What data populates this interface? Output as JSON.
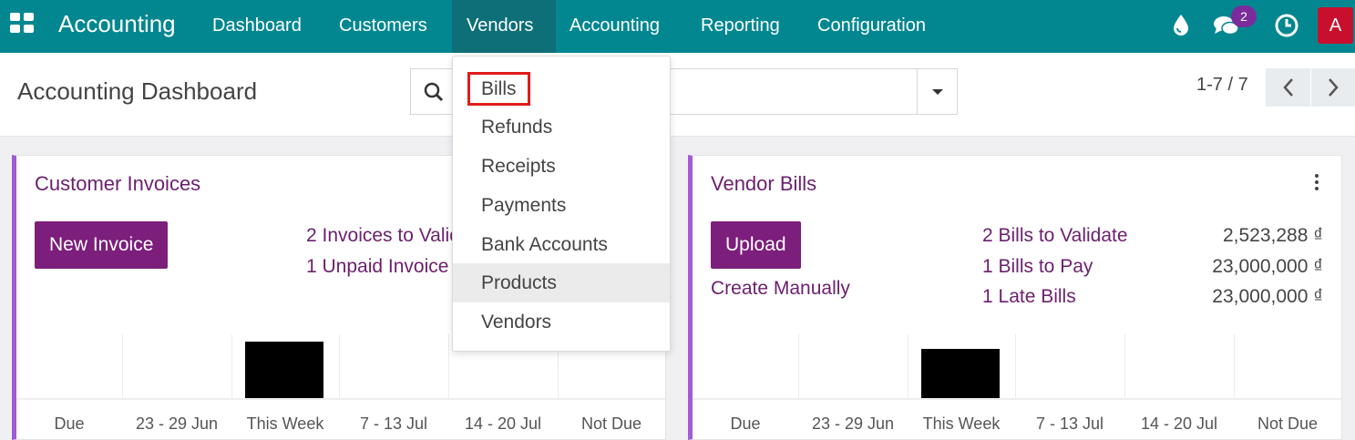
{
  "navbar": {
    "brand": "Accounting",
    "menu": [
      {
        "label": "Dashboard"
      },
      {
        "label": "Customers"
      },
      {
        "label": "Vendors",
        "active": true
      },
      {
        "label": "Accounting"
      },
      {
        "label": "Reporting"
      },
      {
        "label": "Configuration"
      }
    ],
    "messages_badge": "2",
    "avatar_letter": "A",
    "icons": [
      "apps-grid-icon",
      "droplet-icon",
      "chat-bubbles-icon",
      "clock-icon"
    ],
    "colors": {
      "bar": "#028790",
      "active_item": "#0e6f78",
      "badge": "#7b2c9c",
      "avatar": "#c8102e"
    }
  },
  "control_panel": {
    "title": "Accounting Dashboard",
    "search_placeholder": "Search...",
    "pager": "1-7 / 7"
  },
  "vendors_menu": {
    "items": [
      {
        "label": "Bills",
        "highlighted": true
      },
      {
        "label": "Refunds"
      },
      {
        "label": "Receipts"
      },
      {
        "label": "Payments"
      },
      {
        "label": "Bank Accounts"
      },
      {
        "label": "Products",
        "hovered": true
      },
      {
        "label": "Vendors"
      }
    ]
  },
  "customer_invoices": {
    "title": "Customer Invoices",
    "primary_button": "New Invoice",
    "links": [
      "2 Invoices to Validate",
      "1 Unpaid Invoice"
    ],
    "chart_labels": [
      "Due",
      "23 - 29 Jun",
      "This Week",
      "7 - 13 Jul",
      "14 - 20 Jul",
      "Not Due"
    ]
  },
  "vendor_bills": {
    "title": "Vendor Bills",
    "primary_button": "Upload",
    "secondary_link": "Create Manually",
    "rows": [
      {
        "label": "2 Bills to Validate",
        "amount": "2,523,288 ₫"
      },
      {
        "label": "1 Bills to Pay",
        "amount": "23,000,000 ₫"
      },
      {
        "label": "1 Late Bills",
        "amount": "23,000,000 ₫"
      }
    ],
    "chart_labels": [
      "Due",
      "23 - 29 Jun",
      "This Week",
      "7 - 13 Jul",
      "14 - 20 Jul",
      "Not Due"
    ]
  },
  "accent_colors": {
    "card_border": "#a05bd5",
    "primary_button": "#7c1e7b",
    "link": "#6b1f6e",
    "highlight_outline": "#e01b1b"
  }
}
